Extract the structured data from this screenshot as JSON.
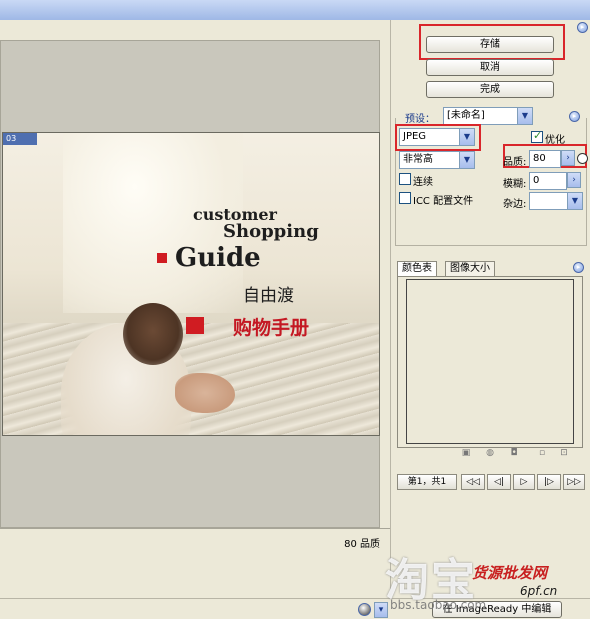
{
  "left": {
    "photo": {
      "tag": "03",
      "line1": "customer",
      "line2": "Shopping",
      "line3": "Guide",
      "line4": "自由渡",
      "line5": "购物手册"
    },
    "status_quality": "80 品质"
  },
  "buttons": {
    "save": "存储",
    "cancel": "取消",
    "done": "完成"
  },
  "settings": {
    "preset_label": "预设：",
    "preset_value": "[未命名]",
    "format_value": "JPEG",
    "quality_level_value": "非常高",
    "optimize_label": "优化",
    "optimize_checked": true,
    "quality_label": "品质:",
    "quality_value": "80",
    "blur_label": "模糊:",
    "blur_value": "0",
    "matte_label": "杂边:",
    "progressive_label": "连续",
    "icc_label": "ICC 配置文件"
  },
  "tabs": [
    {
      "label": "颜色表"
    },
    {
      "label": "图像大小"
    }
  ],
  "frame_nav": {
    "frame_label": "第1，共1",
    "btn_first": "◁◁",
    "btn_prev": "◁|",
    "btn_play": "▷",
    "btn_next": "|▷",
    "btn_last": "▷▷"
  },
  "watermarks": {
    "taobao": "淘宝",
    "site_cn": "货源批发网",
    "site_url": "6pf.cn",
    "bbs": "bbs.taobao.com"
  },
  "bottom": {
    "imageready_label": "在 ImageReady 中编辑"
  }
}
